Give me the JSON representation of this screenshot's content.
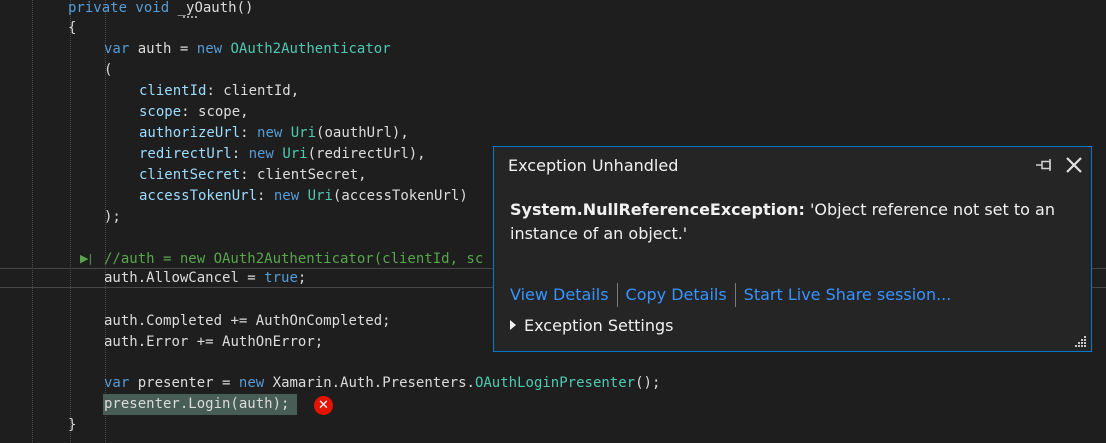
{
  "code": {
    "method_keywords": "private void",
    "method_name": "_yOauth",
    "method_parens": "()",
    "open_brace": "{",
    "close_brace": "}",
    "line_var_keyword": "var",
    "line_var_name": "auth",
    "line_eq": "=",
    "line_new": "new",
    "line_type": "OAuth2Authenticator",
    "open_paren": "(",
    "args": [
      {
        "name": "clientId",
        "kw": "",
        "type": "",
        "value": "clientId,"
      },
      {
        "name": "scope",
        "kw": "",
        "type": "",
        "value": "scope,"
      },
      {
        "name": "authorizeUrl",
        "kw": "new",
        "type": "Uri",
        "value": "(oauthUrl),"
      },
      {
        "name": "redirectUrl",
        "kw": "new",
        "type": "Uri",
        "value": "(redirectUrl),"
      },
      {
        "name": "clientSecret",
        "kw": "",
        "type": "",
        "value": "clientSecret,"
      },
      {
        "name": "accessTokenUrl",
        "kw": "new",
        "type": "Uri",
        "value": "(accessTokenUrl)"
      }
    ],
    "close_call": ");",
    "comment": "//auth = new OAuth2Authenticator(clientId, sc",
    "allow_cancel_obj": "auth.",
    "allow_cancel_prop": "AllowCancel",
    "allow_cancel_rest": " = ",
    "allow_cancel_value": "true",
    "allow_cancel_end": ";",
    "completed_obj": "auth.",
    "completed_prop": "Completed",
    "completed_rest": " += AuthOnCompleted;",
    "error_obj": "auth.",
    "error_prop": "Error",
    "error_rest": " += AuthOnError;",
    "presenter_var_kw": "var",
    "presenter_name": "presenter",
    "presenter_eq": "=",
    "presenter_new": "new",
    "presenter_ns": "Xamarin.Auth.Presenters.",
    "presenter_type": "OAuthLoginPresenter",
    "presenter_end": "();",
    "login_call": "presenter.Login(auth);"
  },
  "exception_popup": {
    "title": "Exception Unhandled",
    "exception_type": "System.NullReferenceException:",
    "exception_message": " 'Object reference not set to an instance of an object.'",
    "links": [
      "View Details",
      "Copy Details",
      "Start Live Share session..."
    ],
    "settings_label": "Exception Settings"
  },
  "icons": {
    "pin": "pin-icon",
    "close": "close-icon",
    "error": "error-glyph-icon",
    "expand": "expand-triangle-icon",
    "resize": "resize-grip-icon"
  },
  "colors": {
    "keyword": "#569cd6",
    "type": "#4ec9b0",
    "parameter": "#9cdcfe",
    "comment": "#57a64a",
    "link": "#3794ff",
    "popup_border": "#007acc",
    "error": "#e51400"
  }
}
